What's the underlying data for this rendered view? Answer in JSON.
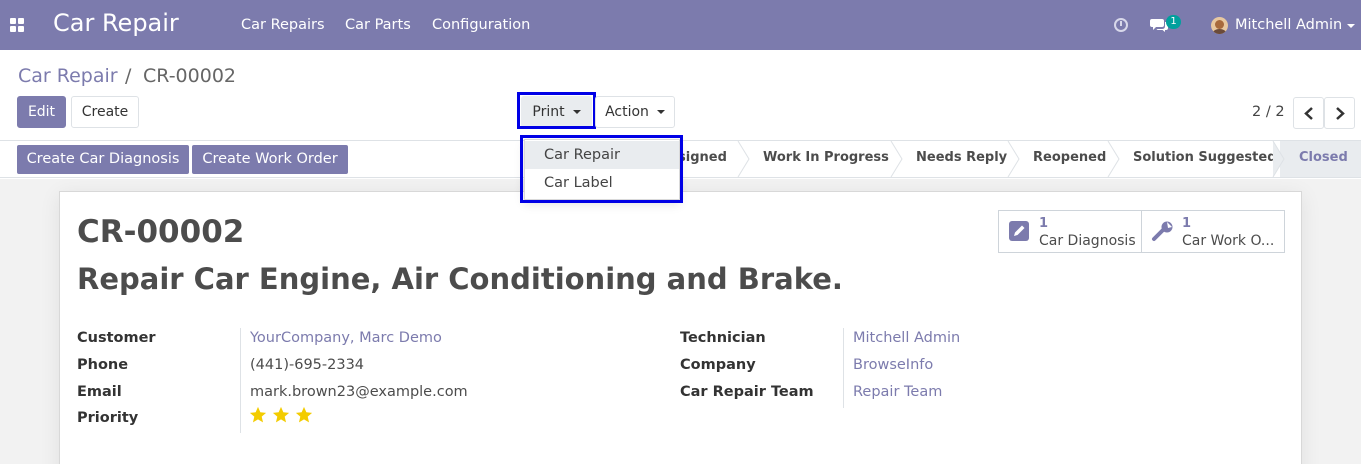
{
  "navbar": {
    "app_title": "Car Repair",
    "menu": [
      "Car Repairs",
      "Car Parts",
      "Configuration"
    ],
    "message_count": "1",
    "user_name": "Mitchell Admin"
  },
  "breadcrumb": {
    "root": "Car Repair",
    "separator": "/",
    "current": "CR-00002"
  },
  "toolbar": {
    "edit": "Edit",
    "create": "Create",
    "print": "Print",
    "action": "Action"
  },
  "pager": {
    "value": "2 / 2"
  },
  "print_menu": {
    "items": [
      "Car Repair",
      "Car Label"
    ],
    "hovered": "Car Repair"
  },
  "statusbar": {
    "buttons": [
      "Create Car Diagnosis",
      "Create Work Order"
    ],
    "stages": [
      "signed",
      "Work In Progress",
      "Needs Reply",
      "Reopened",
      "Solution Suggested",
      "Closed"
    ],
    "current_stage": "Closed"
  },
  "form": {
    "reference": "CR-00002",
    "subject": "Repair Car Engine, Air Conditioning and Brake.",
    "smart_buttons": [
      {
        "count": "1",
        "label": "Car Diagnosis",
        "icon": "edit-icon"
      },
      {
        "count": "1",
        "label": "Car Work O...",
        "icon": "wrench-icon"
      }
    ],
    "left_fields": [
      {
        "label": "Customer",
        "value": "YourCompany, Marc Demo"
      },
      {
        "label": "Phone",
        "value": "(441)-695-2334"
      },
      {
        "label": "Email",
        "value": "mark.brown23@example.com"
      },
      {
        "label": "Priority",
        "value": ""
      }
    ],
    "priority_stars": 3,
    "right_fields": [
      {
        "label": "Technician",
        "value": "Mitchell Admin"
      },
      {
        "label": "Company",
        "value": "BrowseInfo"
      },
      {
        "label": "Car Repair Team",
        "value": "Repair Team"
      }
    ]
  },
  "colors": {
    "brand": "#7c7bad",
    "highlight": "#0000e6",
    "star": "#f3cc00",
    "badge": "#00a09d"
  }
}
